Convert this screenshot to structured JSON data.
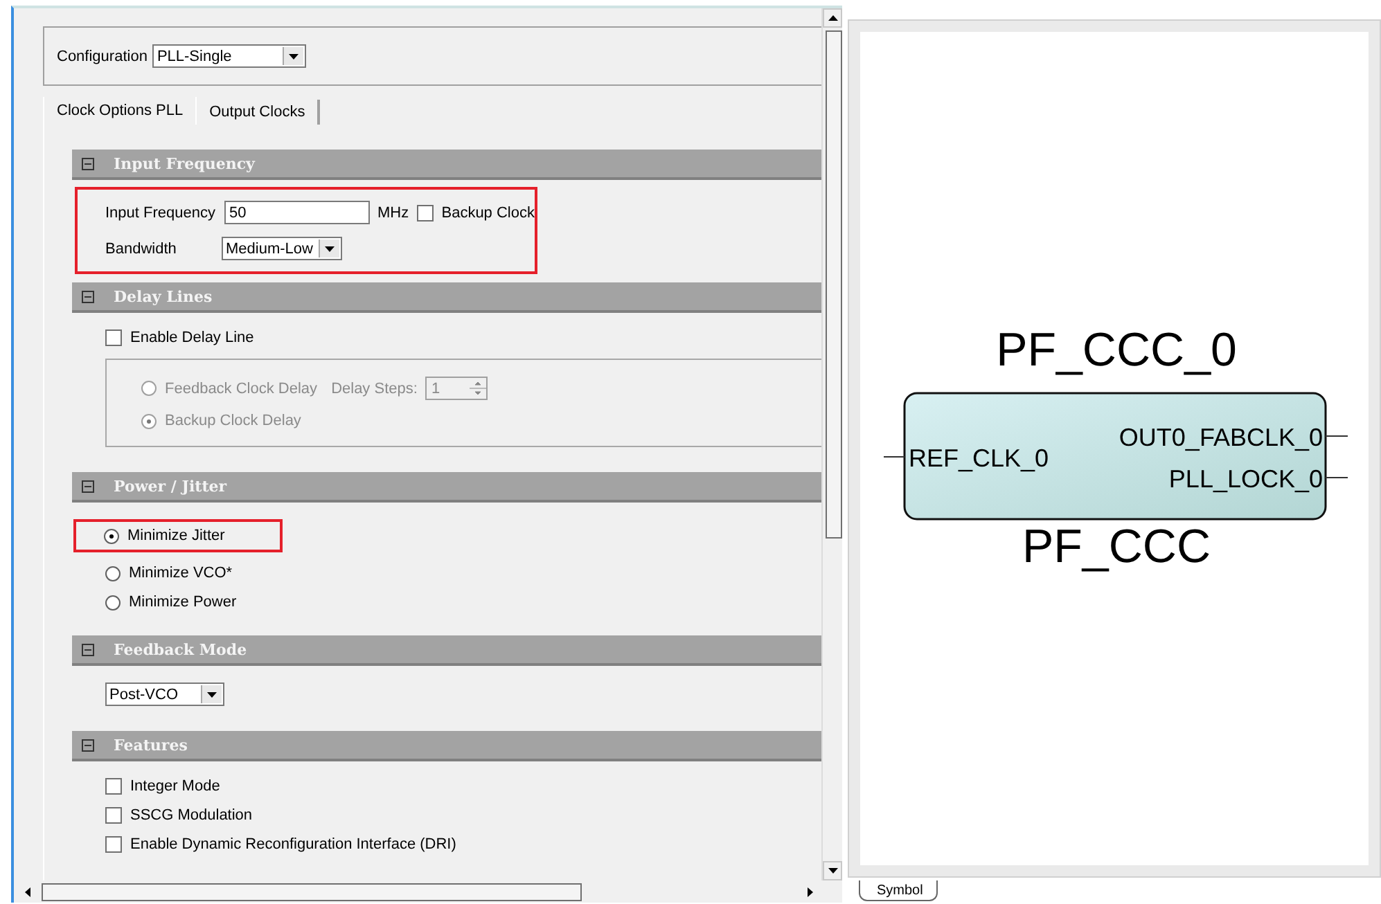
{
  "configuration": {
    "label": "Configuration",
    "value": "PLL-Single"
  },
  "tabs": [
    {
      "label": "Clock Options PLL",
      "selected": true
    },
    {
      "label": "Output Clocks",
      "selected": false
    }
  ],
  "sections": [
    {
      "title": "Input Frequency",
      "highlighted": true,
      "items": [
        {
          "kind": "field",
          "label": "Input Frequency",
          "value": "50",
          "unit": "MHz",
          "check_label": "Backup Clock",
          "checked": false
        },
        {
          "kind": "dropdown",
          "label": "Bandwidth",
          "value": "Medium-Low"
        }
      ]
    },
    {
      "title": "Delay Lines",
      "highlighted": false,
      "items": [
        {
          "kind": "checkbox",
          "label": "Enable Delay Line",
          "checked": false,
          "highlighted": false
        },
        {
          "kind": "group",
          "disabled": true,
          "items": [
            {
              "kind": "radio",
              "label": "Feedback Clock Delay",
              "selected": false,
              "highlighted": false,
              "spin_label": "Delay Steps:",
              "spin_value": "1"
            },
            {
              "kind": "radio",
              "label": "Backup Clock Delay",
              "selected": true,
              "highlighted": false
            }
          ]
        }
      ]
    },
    {
      "title": "Power / Jitter",
      "highlighted": false,
      "items": [
        {
          "kind": "radio",
          "label": "Minimize Jitter",
          "selected": true,
          "highlighted": true
        },
        {
          "kind": "radio",
          "label": "Minimize VCO*",
          "selected": false,
          "highlighted": false
        },
        {
          "kind": "radio",
          "label": "Minimize Power",
          "selected": false,
          "highlighted": false
        }
      ]
    },
    {
      "title": "Feedback Mode",
      "highlighted": false,
      "items": [
        {
          "kind": "dropdown",
          "value": "Post-VCO"
        }
      ]
    },
    {
      "title": "Features",
      "highlighted": false,
      "items": [
        {
          "kind": "checkbox",
          "label": "Integer Mode",
          "checked": false,
          "highlighted": false
        },
        {
          "kind": "checkbox",
          "label": "SSCG Modulation",
          "checked": false,
          "highlighted": false
        },
        {
          "kind": "checkbox",
          "label": "Enable Dynamic Reconfiguration Interface (DRI)",
          "checked": false,
          "highlighted": false
        }
      ]
    }
  ],
  "symbol": {
    "instance": "PF_CCC_0",
    "component": "PF_CCC",
    "inputs": [
      "REF_CLK_0"
    ],
    "outputs": [
      "OUT0_FABCLK_0",
      "PLL_LOCK_0"
    ],
    "tab": "Symbol"
  }
}
